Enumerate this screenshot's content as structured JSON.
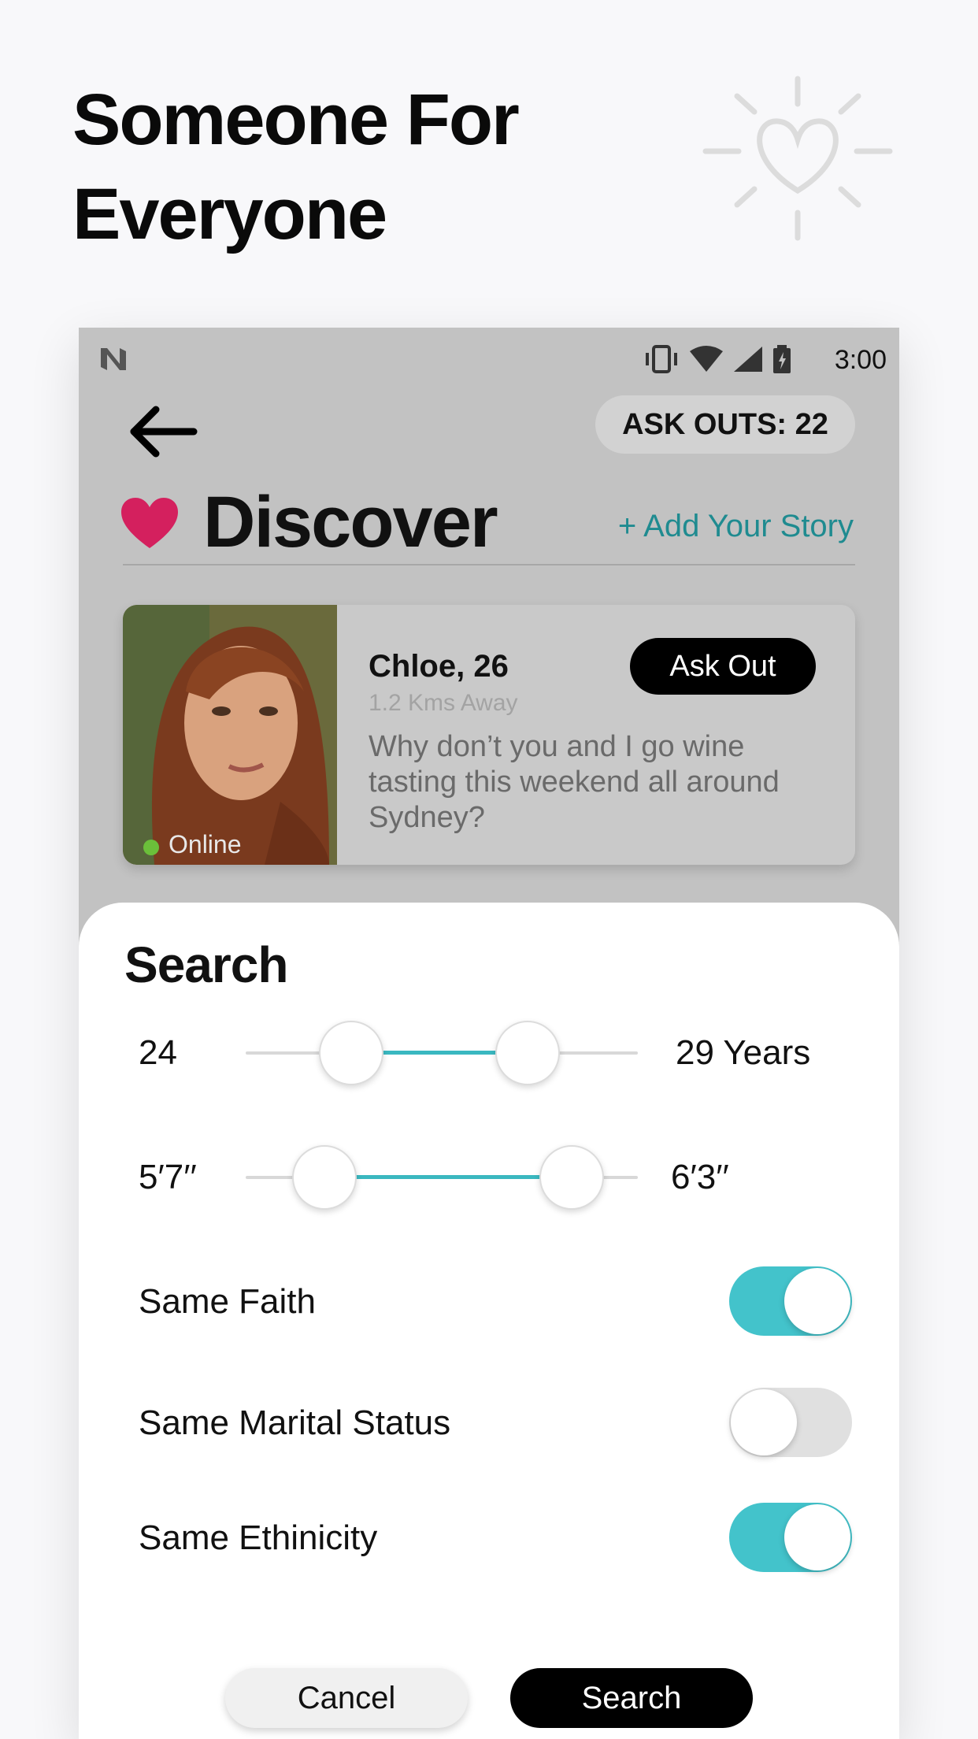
{
  "headline": {
    "line1": "Someone For",
    "line2": "Everyone"
  },
  "status_bar": {
    "time": "3:00"
  },
  "header": {
    "ask_outs": "ASK OUTS: 22"
  },
  "discover": {
    "title": "Discover",
    "add_story": "+ Add Your Story"
  },
  "profile": {
    "name": "Chloe, 26",
    "distance": "1.2 Kms Away",
    "message": "Why don’t you and I go wine tasting this weekend all around Sydney?",
    "status": "Online",
    "ask_out_label": "Ask Out"
  },
  "search_sheet": {
    "title": "Search",
    "age_range": {
      "min": "24",
      "max": "29 Years"
    },
    "height_range": {
      "min": "5′7′′",
      "max": "6′3′′"
    },
    "toggles": [
      {
        "label": "Same Faith",
        "on": true
      },
      {
        "label": "Same Marital Status",
        "on": false
      },
      {
        "label": "Same Ethinicity",
        "on": true
      }
    ],
    "cancel_label": "Cancel",
    "search_label": "Search"
  },
  "colors": {
    "accent": "#43c3cb",
    "heart": "#d4205e",
    "link": "#1f8b90"
  }
}
